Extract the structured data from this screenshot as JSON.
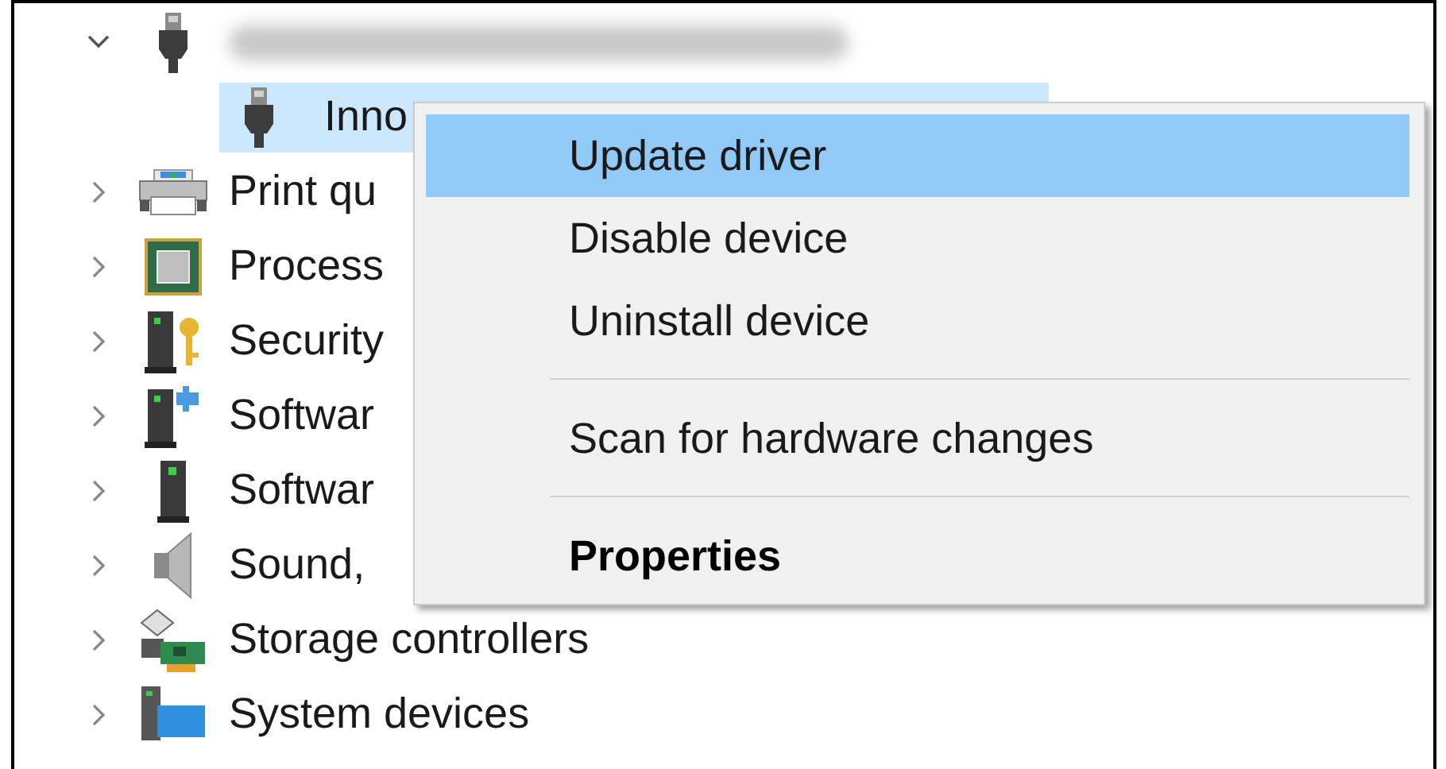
{
  "tree": [
    {
      "expanded": true,
      "selected": false,
      "children": [
        {
          "label": "Inno",
          "selected": true
        }
      ]
    },
    {
      "label": "Print qu",
      "expanded": false,
      "selected": false
    },
    {
      "label": "Process",
      "expanded": false,
      "selected": false
    },
    {
      "label": "Security",
      "expanded": false,
      "selected": false
    },
    {
      "label": "Softwar",
      "expanded": false,
      "selected": false
    },
    {
      "label": "Softwar",
      "expanded": false,
      "selected": false
    },
    {
      "label": "Sound,",
      "expanded": false,
      "selected": false
    },
    {
      "label": "Storage controllers",
      "expanded": false,
      "selected": false
    },
    {
      "label": "System devices",
      "expanded": false,
      "selected": false
    }
  ],
  "context_menu": [
    {
      "kind": "item",
      "label": "Update driver",
      "selected": true,
      "default": false
    },
    {
      "kind": "item",
      "label": "Disable device",
      "selected": false,
      "default": false
    },
    {
      "kind": "item",
      "label": "Uninstall device",
      "selected": false,
      "default": false
    },
    {
      "kind": "separator"
    },
    {
      "kind": "item",
      "label": "Scan for hardware changes",
      "selected": false,
      "default": false
    },
    {
      "kind": "separator"
    },
    {
      "kind": "item",
      "label": "Properties",
      "selected": false,
      "default": true
    }
  ]
}
